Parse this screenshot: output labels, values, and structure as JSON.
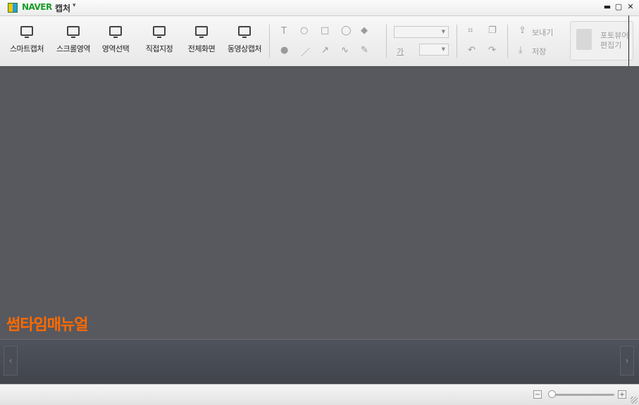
{
  "titlebar": {
    "brand": "NAVER",
    "app_name": "캡처",
    "menu_arrow": "▾",
    "minimize": "▬",
    "maximize": "▢",
    "close": "✕"
  },
  "toolbar": {
    "capture_tools": [
      "스마트캡처",
      "스크롤영역",
      "영역선택",
      "직접지정",
      "전체화면",
      "동영상캡처"
    ],
    "draw_tools": {
      "text": "T",
      "circle": "○",
      "rect": "□",
      "balloon": "◯",
      "fill": "◆",
      "stamp": "●",
      "line": "／",
      "arrow": "↗",
      "curve": "∿",
      "pen": "✎"
    },
    "font_prefix": "가",
    "edit_tools": {
      "crop": "⌗",
      "resize": "❐",
      "undo": "↶",
      "redo": "↷"
    },
    "send_label": "보내기",
    "save_label": "저장",
    "photo_label_1": "포토뷰어",
    "photo_label_2": "편집기"
  },
  "canvas": {
    "watermark": "썸타임매뉴얼"
  },
  "filmstrip": {
    "prev": "‹",
    "next": "›"
  },
  "statusbar": {
    "zoom_out": "−",
    "zoom_in": "+",
    "zoom_level": 0.0
  }
}
